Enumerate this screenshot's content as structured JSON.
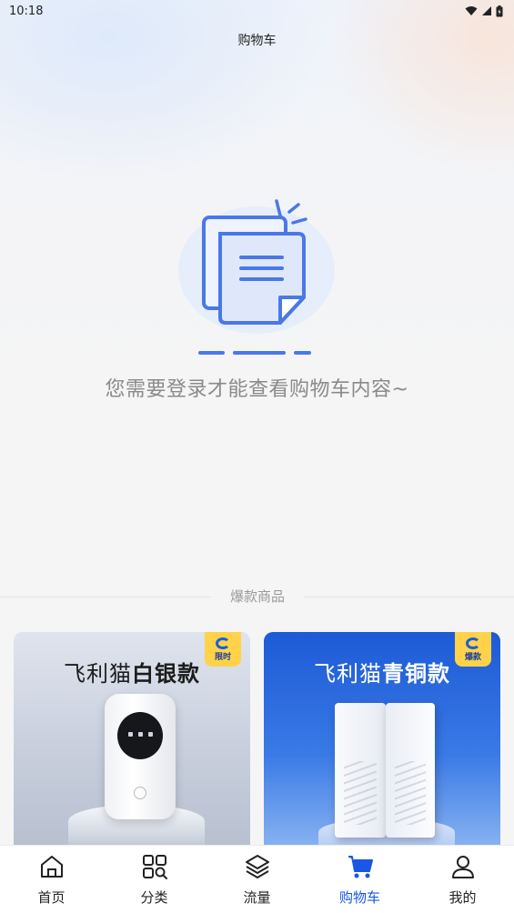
{
  "status_bar": {
    "time": "10:18"
  },
  "header": {
    "title": "购物车"
  },
  "empty_state": {
    "message": "您需要登录才能查看购物车内容~",
    "icon": "document-empty-icon"
  },
  "recommend": {
    "section_title": "爆款商品",
    "products": [
      {
        "title_prefix": "飞利猫",
        "title_bold": "白银款",
        "badge": "限时"
      },
      {
        "title_prefix": "飞利猫",
        "title_bold": "青铜款",
        "badge": "爆款"
      }
    ]
  },
  "tabbar": {
    "active_color": "#1b57e6",
    "items": [
      {
        "label": "首页",
        "icon": "home-icon"
      },
      {
        "label": "分类",
        "icon": "category-icon"
      },
      {
        "label": "流量",
        "icon": "layers-icon"
      },
      {
        "label": "购物车",
        "icon": "cart-icon",
        "active": true
      },
      {
        "label": "我的",
        "icon": "user-icon"
      }
    ]
  }
}
